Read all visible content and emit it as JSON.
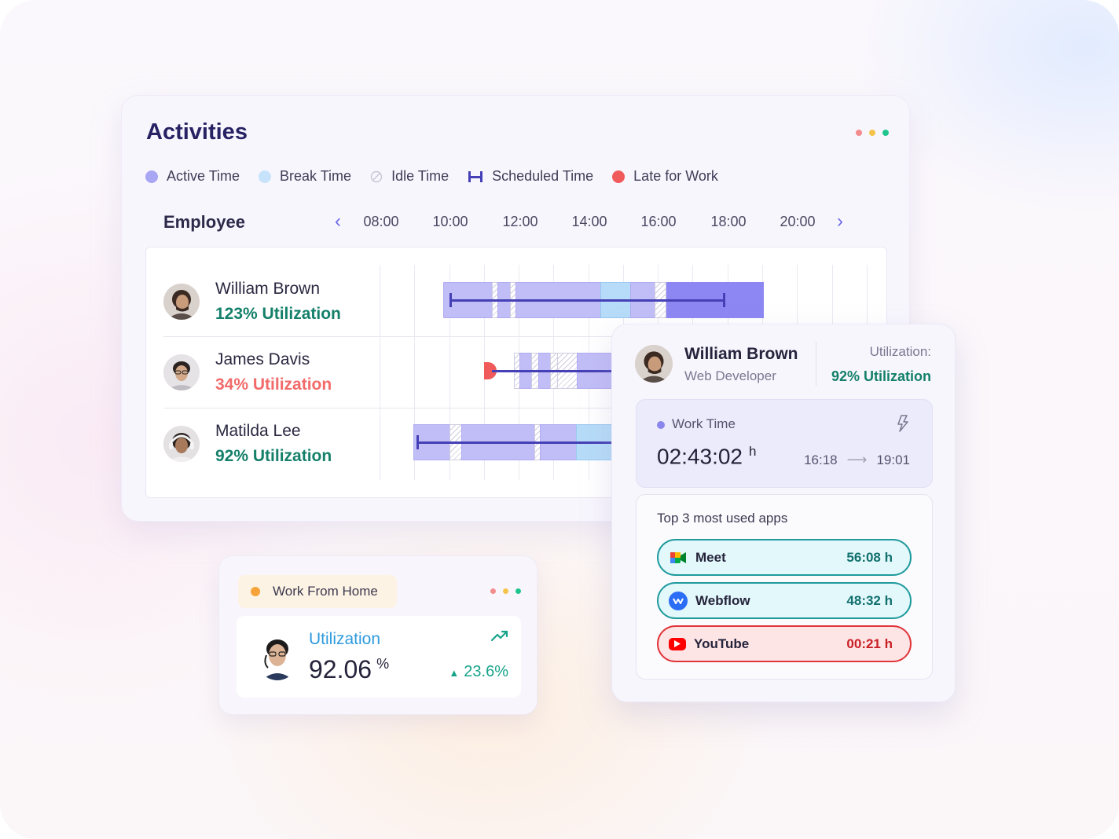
{
  "activities": {
    "title": "Activities",
    "dots": [
      "#f38c8c",
      "#f5c24a",
      "#20c58e"
    ],
    "legend": [
      {
        "label": "Active Time",
        "icon": "active-dot",
        "color": "#a9a6f4"
      },
      {
        "label": "Break Time",
        "icon": "break-dot",
        "color": "#bfe0fb"
      },
      {
        "label": "Idle Time",
        "icon": "idle-icon",
        "color": "#cccad8"
      },
      {
        "label": "Scheduled Time",
        "icon": "scheduled-icon",
        "color": "#4540b5"
      },
      {
        "label": "Late for Work",
        "icon": "late-dot",
        "color": "#f15a5a"
      }
    ],
    "employee_header": "Employee",
    "times": [
      "08:00",
      "10:00",
      "12:00",
      "14:00",
      "16:00",
      "18:00",
      "20:00"
    ],
    "employees": [
      {
        "name": "William Brown",
        "utilization": "123% Utilization",
        "util_color": "#14806a"
      },
      {
        "name": "James Davis",
        "utilization": "34% Utilization",
        "util_color": "#f26a6a"
      },
      {
        "name": "Matilda Lee",
        "utilization": "92% Utilization",
        "util_color": "#14806a"
      }
    ]
  },
  "detail": {
    "name": "William Brown",
    "role": "Web Developer",
    "util_label": "Utilization:",
    "util_value": "92% Utilization",
    "work_time_label": "Work Time",
    "work_time_value": "02:43:02",
    "work_time_unit": "h",
    "range_start": "16:18",
    "range_end": "19:01",
    "apps_title": "Top 3 most used apps",
    "apps": [
      {
        "name": "Meet",
        "time": "56:08 h",
        "border": "#1f9a9d",
        "bg": "#e2f8fb",
        "time_color": "#12706f",
        "icon": "meet-icon"
      },
      {
        "name": "Webflow",
        "time": "48:32 h",
        "border": "#1f9a9d",
        "bg": "#e2f8fb",
        "time_color": "#12706f",
        "icon": "webflow-icon"
      },
      {
        "name": "YouTube",
        "time": "00:21 h",
        "border": "#e0353a",
        "bg": "#fde4e5",
        "time_color": "#c81f24",
        "icon": "youtube-icon"
      }
    ]
  },
  "wfh": {
    "tag": "Work From Home",
    "label": "Utilization",
    "value": "92.06",
    "unit": "%",
    "delta": "23.6%",
    "dots": [
      "#f38c8c",
      "#f5c24a",
      "#20c58e"
    ]
  }
}
